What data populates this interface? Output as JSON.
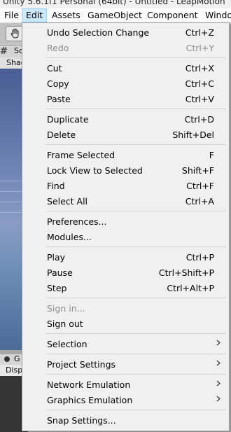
{
  "window": {
    "title": "Unity 5.6.1f1 Personal (64bit) - Untitled - LeapMotion"
  },
  "menubar": [
    {
      "label": "File"
    },
    {
      "label": "Edit",
      "active": true
    },
    {
      "label": "Assets"
    },
    {
      "label": "GameObject"
    },
    {
      "label": "Component"
    },
    {
      "label": "Windo"
    }
  ],
  "background": {
    "scene_tab": "Sc",
    "scene_sub": "Shad",
    "game_tab": "G",
    "game_sub": "Disp"
  },
  "edit_menu": {
    "items": [
      {
        "label": "Undo Selection Change",
        "shortcut": "Ctrl+Z",
        "enabled": true
      },
      {
        "label": "Redo",
        "shortcut": "Ctrl+Y",
        "enabled": false
      },
      {
        "separator": true
      },
      {
        "label": "Cut",
        "shortcut": "Ctrl+X",
        "enabled": true
      },
      {
        "label": "Copy",
        "shortcut": "Ctrl+C",
        "enabled": true
      },
      {
        "label": "Paste",
        "shortcut": "Ctrl+V",
        "enabled": true
      },
      {
        "separator": true
      },
      {
        "label": "Duplicate",
        "shortcut": "Ctrl+D",
        "enabled": true
      },
      {
        "label": "Delete",
        "shortcut": "Shift+Del",
        "enabled": true
      },
      {
        "separator": true
      },
      {
        "label": "Frame Selected",
        "shortcut": "F",
        "enabled": true
      },
      {
        "label": "Lock View to Selected",
        "shortcut": "Shift+F",
        "enabled": true
      },
      {
        "label": "Find",
        "shortcut": "Ctrl+F",
        "enabled": true
      },
      {
        "label": "Select All",
        "shortcut": "Ctrl+A",
        "enabled": true
      },
      {
        "separator": true
      },
      {
        "label": "Preferences...",
        "shortcut": "",
        "enabled": true
      },
      {
        "label": "Modules...",
        "shortcut": "",
        "enabled": true
      },
      {
        "separator": true
      },
      {
        "label": "Play",
        "shortcut": "Ctrl+P",
        "enabled": true
      },
      {
        "label": "Pause",
        "shortcut": "Ctrl+Shift+P",
        "enabled": true
      },
      {
        "label": "Step",
        "shortcut": "Ctrl+Alt+P",
        "enabled": true
      },
      {
        "separator": true
      },
      {
        "label": "Sign in...",
        "shortcut": "",
        "enabled": false
      },
      {
        "label": "Sign out",
        "shortcut": "",
        "enabled": true
      },
      {
        "separator": true
      },
      {
        "label": "Selection",
        "shortcut": "",
        "enabled": true,
        "submenu": true
      },
      {
        "separator": true
      },
      {
        "label": "Project Settings",
        "shortcut": "",
        "enabled": true,
        "submenu": true
      },
      {
        "separator": true
      },
      {
        "label": "Network Emulation",
        "shortcut": "",
        "enabled": true,
        "submenu": true
      },
      {
        "label": "Graphics Emulation",
        "shortcut": "",
        "enabled": true,
        "submenu": true
      },
      {
        "separator": true
      },
      {
        "label": "Snap Settings...",
        "shortcut": "",
        "enabled": true
      }
    ]
  },
  "colors": {
    "menu_bg": "#f0f0f0",
    "menubar_active_bg": "#cce8ff",
    "disabled_text": "#8d8d8d"
  }
}
